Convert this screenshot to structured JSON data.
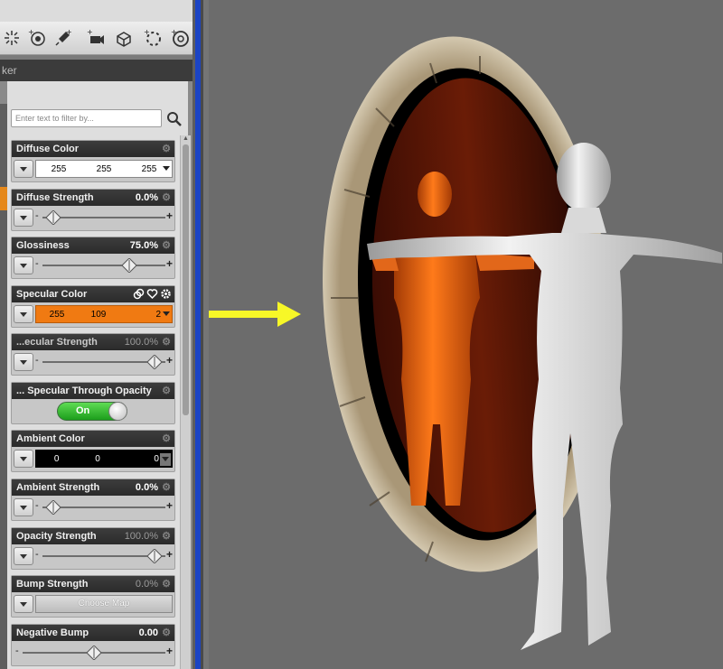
{
  "panel": {
    "title": "ker"
  },
  "filter": {
    "placeholder": "Enter text to filter by..."
  },
  "toolbar": {
    "icons": [
      "light-burst-icon",
      "light-plus-icon",
      "spotlight-icon",
      "camera-plus-icon",
      "cube-plus-icon",
      "dotted-circle-icon",
      "refresh-circle-icon"
    ]
  },
  "colors": {
    "specular": "#f07a12",
    "toggle_on": "#2cb72c",
    "arrow": "#f7f727"
  },
  "properties": {
    "diffuse_color": {
      "label": "Diffuse Color",
      "r": "255",
      "g": "255",
      "b": "255"
    },
    "diffuse_strength": {
      "label": "Diffuse Strength",
      "value": "0.0%",
      "level": 0.0
    },
    "glossiness": {
      "label": "Glossiness",
      "value": "75.0%",
      "level": 0.75
    },
    "specular_color": {
      "label": "Specular Color",
      "r": "255",
      "g": "109",
      "b": "2"
    },
    "specular_strength": {
      "label": "...ecular Strength",
      "value": "100.0%",
      "level": 1.0
    },
    "specular_through_opacity": {
      "label": "... Specular Through Opacity",
      "state": "On"
    },
    "ambient_color": {
      "label": "Ambient Color",
      "r": "0",
      "g": "0",
      "b": "0"
    },
    "ambient_strength": {
      "label": "Ambient Strength",
      "value": "0.0%",
      "level": 0.0
    },
    "opacity_strength": {
      "label": "Opacity Strength",
      "value": "100.0%",
      "level": 1.0
    },
    "bump_strength": {
      "label": "Bump Strength",
      "value": "0.0%",
      "map_label": "Choose Map"
    },
    "negative_bump": {
      "label": "Negative Bump",
      "value": "0.00",
      "level": 0.5
    }
  }
}
